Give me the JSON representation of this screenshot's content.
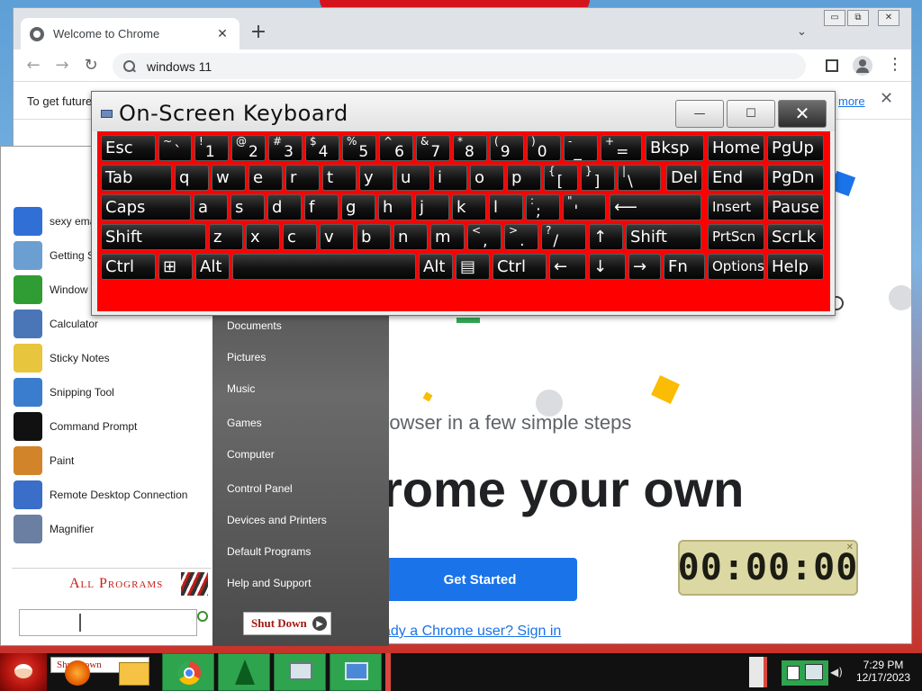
{
  "chrome": {
    "tab_title": "Welcome to Chrome",
    "tab_close": "✕",
    "new_tab": "+",
    "tab_dropdown": "⌄",
    "back": "←",
    "forward": "→",
    "reload": "↻",
    "omnibox_text": "windows 11",
    "infobar_text": "To get future",
    "infobar_link": "more",
    "infobar_close": "✕",
    "hero_subtitle": "rowser in a few simple steps",
    "hero_title": "rome your own",
    "get_started": "Get Started",
    "signin_link": "ady a Chrome user? Sign in",
    "window_controls": [
      "▭",
      "⧉",
      "✕"
    ]
  },
  "osk": {
    "title": "On-Screen Keyboard",
    "minimize": "—",
    "restore": "☐",
    "close": "✕",
    "accent": "#ff0000",
    "rows": [
      [
        {
          "label": "Esc"
        },
        {
          "top": "~",
          "label": "`"
        },
        {
          "top": "!",
          "label": "1"
        },
        {
          "top": "@",
          "label": "2"
        },
        {
          "top": "#",
          "label": "3"
        },
        {
          "top": "$",
          "label": "4"
        },
        {
          "top": "%",
          "label": "5"
        },
        {
          "top": "^",
          "label": "6"
        },
        {
          "top": "&",
          "label": "7"
        },
        {
          "top": "*",
          "label": "8"
        },
        {
          "top": "(",
          "label": "9"
        },
        {
          "top": ")",
          "label": "0"
        },
        {
          "top": "-",
          "label": "_"
        },
        {
          "top": "+",
          "label": "="
        },
        {
          "label": "Bksp"
        },
        {
          "label": "Home"
        },
        {
          "label": "PgUp"
        }
      ],
      [
        {
          "label": "Tab"
        },
        {
          "label": "q"
        },
        {
          "label": "w"
        },
        {
          "label": "e"
        },
        {
          "label": "r"
        },
        {
          "label": "t"
        },
        {
          "label": "y"
        },
        {
          "label": "u"
        },
        {
          "label": "i"
        },
        {
          "label": "o"
        },
        {
          "label": "p"
        },
        {
          "top": "{",
          "label": "["
        },
        {
          "top": "}",
          "label": "]"
        },
        {
          "top": "|",
          "label": "\\"
        },
        {
          "label": "Del"
        },
        {
          "label": "End"
        },
        {
          "label": "PgDn"
        }
      ],
      [
        {
          "label": "Caps"
        },
        {
          "label": "a"
        },
        {
          "label": "s"
        },
        {
          "label": "d"
        },
        {
          "label": "f"
        },
        {
          "label": "g"
        },
        {
          "label": "h"
        },
        {
          "label": "j"
        },
        {
          "label": "k"
        },
        {
          "label": "l"
        },
        {
          "top": ":",
          "label": ";"
        },
        {
          "top": "\"",
          "label": "'"
        },
        {
          "label": "⟵"
        },
        {
          "label": "Insert"
        },
        {
          "label": "Pause"
        }
      ],
      [
        {
          "label": "Shift"
        },
        {
          "label": "z"
        },
        {
          "label": "x"
        },
        {
          "label": "c"
        },
        {
          "label": "v"
        },
        {
          "label": "b"
        },
        {
          "label": "n"
        },
        {
          "label": "m"
        },
        {
          "top": "<",
          "label": ","
        },
        {
          "top": ">",
          "label": "."
        },
        {
          "top": "?",
          "label": "/"
        },
        {
          "label": "↑"
        },
        {
          "label": "Shift"
        },
        {
          "label": "PrtScn"
        },
        {
          "label": "ScrLk"
        }
      ],
      [
        {
          "label": "Ctrl"
        },
        {
          "label": "⊞"
        },
        {
          "label": "Alt"
        },
        {
          "label": ""
        },
        {
          "label": "Alt"
        },
        {
          "label": "▤"
        },
        {
          "label": "Ctrl"
        },
        {
          "label": "←"
        },
        {
          "label": "↓"
        },
        {
          "label": "→"
        },
        {
          "label": "Fn"
        },
        {
          "label": "Options"
        },
        {
          "label": "Help"
        }
      ]
    ]
  },
  "start_menu": {
    "left_items": [
      {
        "label": "sexy ema",
        "icon": "thunderbird-icon"
      },
      {
        "label": "Getting S",
        "icon": "getting-started-icon"
      },
      {
        "label": "Window",
        "icon": "windows-media-icon"
      },
      {
        "label": "Calculator",
        "icon": "calculator-icon"
      },
      {
        "label": "Sticky Notes",
        "icon": "sticky-notes-icon"
      },
      {
        "label": "Snipping Tool",
        "icon": "snipping-tool-icon"
      },
      {
        "label": "Command Prompt",
        "icon": "command-prompt-icon"
      },
      {
        "label": "Paint",
        "icon": "paint-icon"
      },
      {
        "label": "Remote Desktop Connection",
        "icon": "remote-desktop-icon"
      },
      {
        "label": "Magnifier",
        "icon": "magnifier-icon"
      }
    ],
    "all_programs": "All Programs",
    "right_items": [
      "Documents",
      "Pictures",
      "Music",
      "Games",
      "Computer",
      "Control Panel",
      "Devices and Printers",
      "Default Programs",
      "Help and Support"
    ],
    "shutdown": "Shut Down"
  },
  "timer": {
    "display": "00:00:00",
    "close": "✕"
  },
  "taskbar": {
    "time": "7:29 PM",
    "date": "12/17/2023",
    "start_label": "Shut Down"
  }
}
